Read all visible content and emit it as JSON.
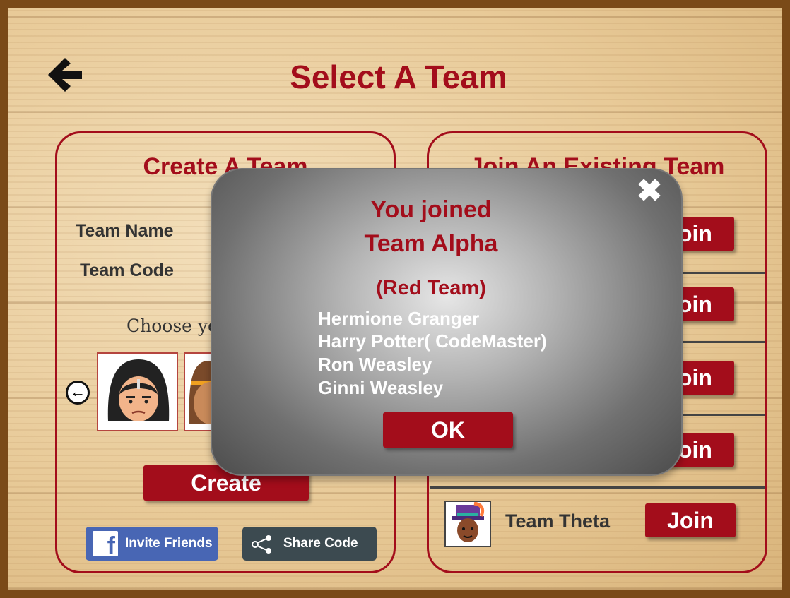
{
  "page": {
    "title": "Select A Team",
    "back_icon": "arrow-left-icon"
  },
  "create_panel": {
    "title": "Create A Team",
    "team_name_label": "Team Name",
    "team_code_label": "Team Code",
    "choose_label": "Choose your",
    "create_button": "Create",
    "invite_button": "Invite Friends",
    "share_button": "Share Code"
  },
  "join_panel": {
    "title": "Join An Existing Team",
    "join_label": "Join",
    "teams": [
      {
        "name": "Team Theta",
        "join_label": "Join"
      }
    ]
  },
  "modal": {
    "line1": "You joined",
    "line2": "Team Alpha",
    "line3": "(Red Team)",
    "members": [
      "Hermione Granger",
      "Harry Potter( CodeMaster)",
      "Ron Weasley",
      "Ginni Weasley"
    ],
    "ok_button": "OK",
    "close_icon": "close-icon"
  },
  "colors": {
    "accent": "#a30d1b",
    "facebook": "#4866b4",
    "share": "#3c4a50",
    "wood_frame": "#7a4a18"
  }
}
